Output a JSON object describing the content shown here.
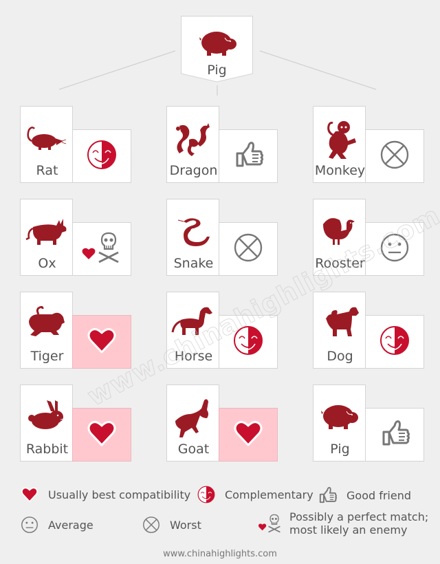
{
  "top": {
    "animal": "Pig",
    "icon": "pig-icon"
  },
  "colors": {
    "background": "#efefef",
    "animal_red": "#9b1b24",
    "accent_red": "#c8102e",
    "best_bg": "#ffc8cf",
    "icon_gray": "#777777",
    "line_gray": "#cccccc"
  },
  "matches": [
    {
      "animal": "Rat",
      "icon": "rat-icon",
      "rating": "complementary"
    },
    {
      "animal": "Dragon",
      "icon": "dragon-icon",
      "rating": "good-friend"
    },
    {
      "animal": "Monkey",
      "icon": "monkey-icon",
      "rating": "worst"
    },
    {
      "animal": "Ox",
      "icon": "ox-icon",
      "rating": "perfect-or-enemy"
    },
    {
      "animal": "Snake",
      "icon": "snake-icon",
      "rating": "worst"
    },
    {
      "animal": "Rooster",
      "icon": "rooster-icon",
      "rating": "average"
    },
    {
      "animal": "Tiger",
      "icon": "tiger-icon",
      "rating": "best"
    },
    {
      "animal": "Horse",
      "icon": "horse-icon",
      "rating": "complementary"
    },
    {
      "animal": "Dog",
      "icon": "dog-icon",
      "rating": "complementary"
    },
    {
      "animal": "Rabbit",
      "icon": "rabbit-icon",
      "rating": "best"
    },
    {
      "animal": "Goat",
      "icon": "goat-icon",
      "rating": "best"
    },
    {
      "animal": "Pig",
      "icon": "pig-icon",
      "rating": "good-friend"
    }
  ],
  "legend": [
    {
      "key": "best",
      "icon": "heart-icon",
      "label": "Usually best compatibility"
    },
    {
      "key": "complementary",
      "icon": "half-smiley-icon",
      "label": "Complementary"
    },
    {
      "key": "good-friend",
      "icon": "thumbs-up-icon",
      "label": "Good friend"
    },
    {
      "key": "average",
      "icon": "neutral-face-icon",
      "label": "Average"
    },
    {
      "key": "worst",
      "icon": "circle-x-icon",
      "label": "Worst"
    },
    {
      "key": "perfect-or-enemy",
      "icon": "heart-skull-icon",
      "label_line1": "Possibly a perfect match;",
      "label_line2": "most likely an enemy"
    }
  ],
  "watermark": "www.chinahighlights.com",
  "footer": "www.chinahighlights.com"
}
